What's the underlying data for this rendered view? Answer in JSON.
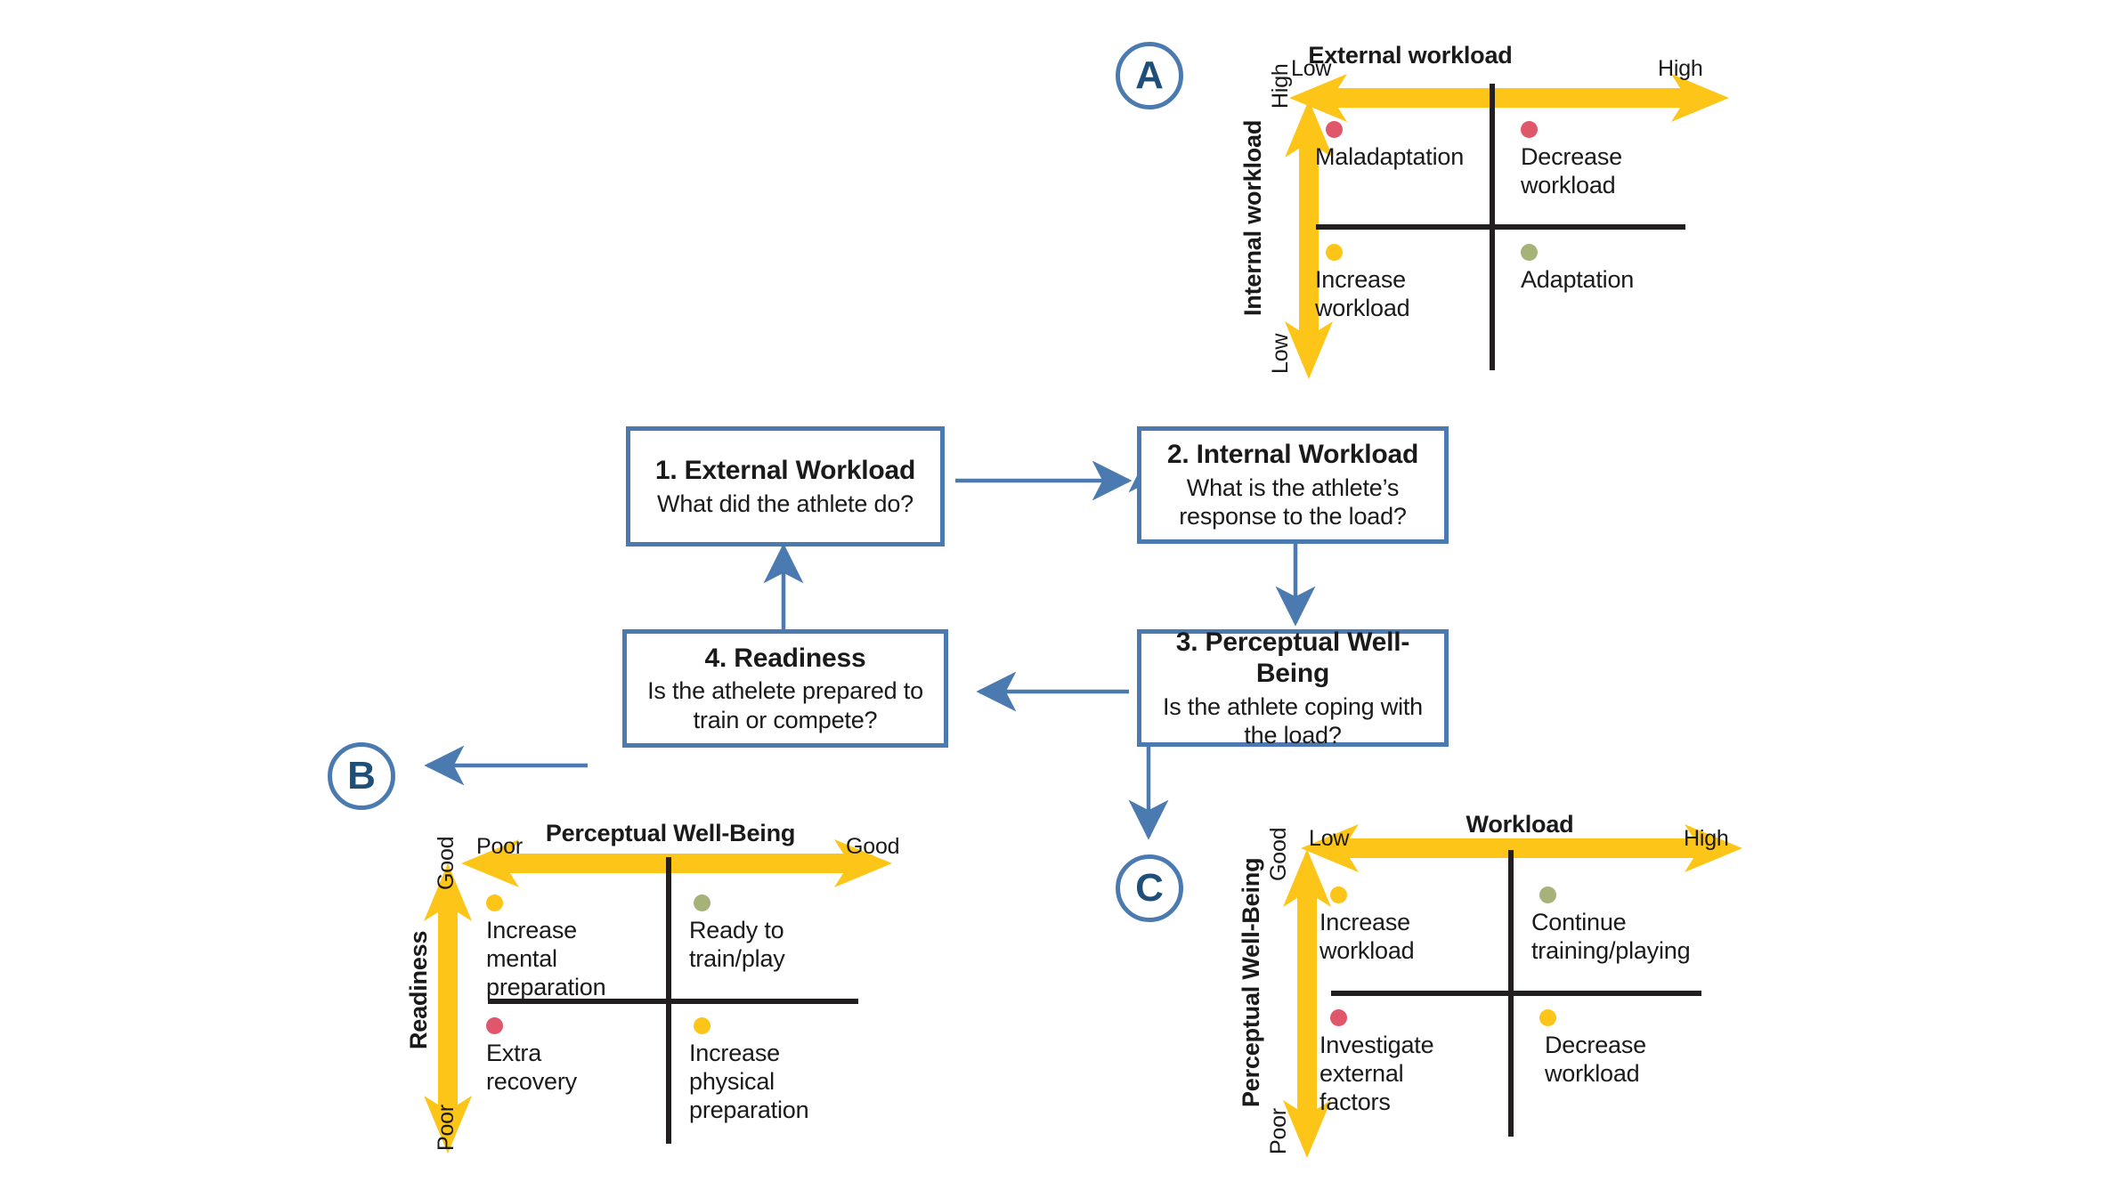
{
  "colors": {
    "blue_line": "#4a7ab0",
    "blue_dark": "#1f4e79",
    "yellow": "#fcc518",
    "black": "#231f20",
    "dot_red": "#e0566a",
    "dot_yellow": "#fcc518",
    "dot_green": "#a6b378"
  },
  "badges": {
    "a": "A",
    "b": "B",
    "c": "C"
  },
  "process": {
    "box1": {
      "title": "1. External Workload",
      "subtitle": "What did the athlete do?"
    },
    "box2": {
      "title": "2. Internal Workload",
      "subtitle": "What is the athlete’s\nresponse to the load?"
    },
    "box3": {
      "title": "3. Perceptual Well-Being",
      "subtitle": "Is the athlete coping with\nthe load?"
    },
    "box4": {
      "title": "4. Readiness",
      "subtitle": "Is the athelete prepared to\ntrain or compete?"
    }
  },
  "chart_data": [
    {
      "id": "A",
      "type": "scatter",
      "title": "External workload",
      "xlabel": "External workload",
      "ylabel": "Internal workload",
      "x_ticks": [
        "Low",
        "High"
      ],
      "y_ticks": [
        "Low",
        "High"
      ],
      "grid": false,
      "legend": "none",
      "quadrants": [
        {
          "position": "top-left",
          "label": "Maladaptation",
          "marker": "red",
          "x": "low",
          "y": "high"
        },
        {
          "position": "top-right",
          "label": "Decrease workload",
          "marker": "red",
          "x": "high",
          "y": "high"
        },
        {
          "position": "bottom-left",
          "label": "Increase workload",
          "marker": "yellow",
          "x": "low",
          "y": "low"
        },
        {
          "position": "bottom-right",
          "label": "Adaptation",
          "marker": "green",
          "x": "high",
          "y": "low"
        }
      ]
    },
    {
      "id": "B",
      "type": "scatter",
      "title": "Perceptual Well-Being",
      "xlabel": "Perceptual Well-Being",
      "ylabel": "Readiness",
      "x_ticks": [
        "Poor",
        "Good"
      ],
      "y_ticks": [
        "Poor",
        "Good"
      ],
      "grid": false,
      "legend": "none",
      "quadrants": [
        {
          "position": "top-left",
          "label": "Increase mental\npreparation",
          "marker": "yellow",
          "x": "poor",
          "y": "good"
        },
        {
          "position": "top-right",
          "label": "Ready to train/play",
          "marker": "green",
          "x": "good",
          "y": "good"
        },
        {
          "position": "bottom-left",
          "label": "Extra recovery",
          "marker": "red",
          "x": "poor",
          "y": "poor"
        },
        {
          "position": "bottom-right",
          "label": "Increase physical\npreparation",
          "marker": "yellow",
          "x": "good",
          "y": "poor"
        }
      ]
    },
    {
      "id": "C",
      "type": "scatter",
      "title": "Workload",
      "xlabel": "Workload",
      "ylabel": "Perceptual Well-Being",
      "x_ticks": [
        "Low",
        "High"
      ],
      "y_ticks": [
        "Poor",
        "Good"
      ],
      "grid": false,
      "legend": "none",
      "quadrants": [
        {
          "position": "top-left",
          "label": "Increase workload",
          "marker": "yellow",
          "x": "low",
          "y": "good"
        },
        {
          "position": "top-right",
          "label": "Continue training/playing",
          "marker": "green",
          "x": "high",
          "y": "good"
        },
        {
          "position": "bottom-left",
          "label": "Investigate\nexternal factors",
          "marker": "red",
          "x": "low",
          "y": "poor"
        },
        {
          "position": "bottom-right",
          "label": "Decrease workload",
          "marker": "yellow",
          "x": "high",
          "y": "poor"
        }
      ]
    }
  ],
  "panelA": {
    "title": "External workload",
    "x_low": "Low",
    "x_high": "High",
    "y_name": "Internal workload",
    "y_high": "High",
    "y_low": "Low",
    "q_tl": "Maladaptation",
    "q_tr": "Decrease workload",
    "q_bl": "Increase workload",
    "q_br": "Adaptation"
  },
  "panelB": {
    "title": "Perceptual Well-Being",
    "x_low": "Poor",
    "x_high": "Good",
    "y_name": "Readiness",
    "y_high": "Good",
    "y_low": "Poor",
    "q_tl_1": "Increase mental",
    "q_tl_2": "preparation",
    "q_tr": "Ready to train/play",
    "q_bl": "Extra recovery",
    "q_br_1": "Increase physical",
    "q_br_2": "preparation"
  },
  "panelC": {
    "title": "Workload",
    "x_low": "Low",
    "x_high": "High",
    "y_name": "Perceptual Well-Being",
    "y_high": "Good",
    "y_low": "Poor",
    "q_tl": "Increase workload",
    "q_tr": "Continue training/playing",
    "q_bl_1": "Investigate",
    "q_bl_2": "external factors",
    "q_br": "Decrease workload"
  }
}
